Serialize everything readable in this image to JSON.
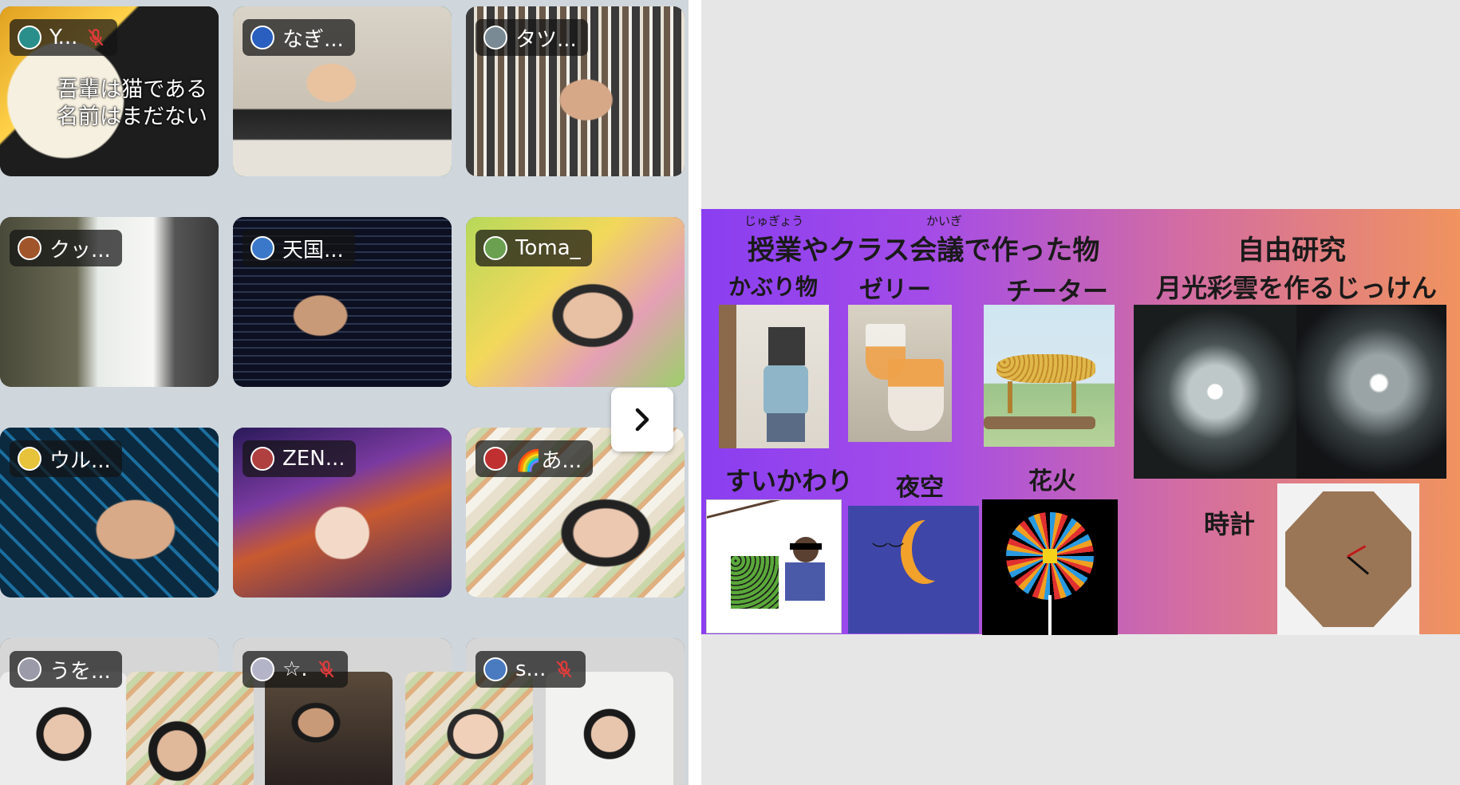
{
  "participants": [
    {
      "name": "Y...",
      "muted": true,
      "avatar_color": "#2a8f8a",
      "overlay_text": [
        "吾輩は猫である",
        "名前はまだない"
      ]
    },
    {
      "name": "なぎ...",
      "muted": false,
      "avatar_color": "#2a5fbf",
      "active": true
    },
    {
      "name": "タツ...",
      "muted": false,
      "avatar_color": "#7a8a95"
    },
    {
      "name": "クッ...",
      "muted": false,
      "avatar_color": "#a0552a"
    },
    {
      "name": "天国...",
      "muted": false,
      "avatar_color": "#3b78c9"
    },
    {
      "name": "Toma_",
      "muted": false,
      "avatar_color": "#6aa050"
    },
    {
      "name": "ウル...",
      "muted": false,
      "avatar_color": "#e6c33a"
    },
    {
      "name": "ZEN...",
      "muted": false,
      "avatar_color": "#b04040"
    },
    {
      "name": "🌈あ...",
      "muted": false,
      "avatar_color": "#c03030"
    },
    {
      "name": "うを...",
      "muted": false,
      "avatar_color": "#9a9aa8"
    },
    {
      "name": "☆.",
      "muted": true,
      "avatar_color": "#b4b4c8"
    },
    {
      "name": "s...",
      "muted": true,
      "avatar_color": "#4a7ac0"
    }
  ],
  "colors": {
    "active_speaker": "#2e9e4f",
    "mic_muted": "#e23b3b"
  },
  "slide": {
    "left_header": "授業やクラス会議で作った物",
    "ruby_jugyou": "じゅぎょう",
    "ruby_kaigi": "かいぎ",
    "right_header": "自由研究",
    "right_subheader": "月光彩雲を作るじっけん",
    "labels": {
      "kaburimono": "かぶり物",
      "jelly": "ゼリー",
      "cheetah": "チーター",
      "suikawari": "すいかわり",
      "yozora": "夜空",
      "hanabi": "花火",
      "tokei": "時計"
    }
  },
  "icons": {
    "next": "chevron-right-icon",
    "mic": "mic-off-icon"
  }
}
